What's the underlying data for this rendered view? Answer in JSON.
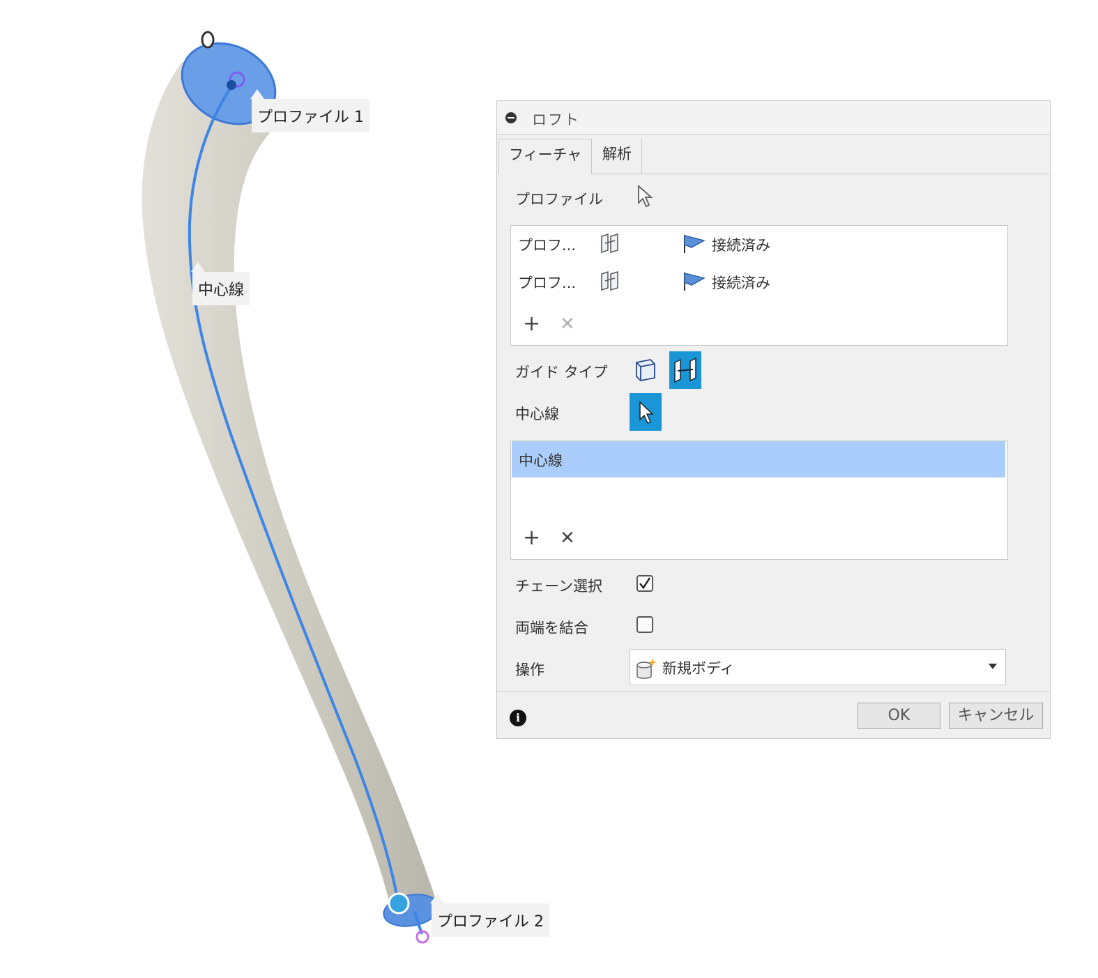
{
  "viewport": {
    "callout_profile1": "プロファイル 1",
    "callout_centerline": "中心線",
    "callout_profile2": "プロファイル 2"
  },
  "dialog": {
    "title": "ロフト",
    "tabs": [
      {
        "label": "フィーチャ",
        "active": true
      },
      {
        "label": "解析",
        "active": false
      }
    ],
    "profile_label": "プロファイル",
    "profiles": [
      {
        "name": "プロフ...",
        "status": "接続済み"
      },
      {
        "name": "プロフ...",
        "status": "接続済み"
      }
    ],
    "guide_type_label": "ガイド タイプ",
    "centerline_label": "中心線",
    "centerline_items": [
      "中心線"
    ],
    "chain_select_label": "チェーン選択",
    "chain_select_checked": true,
    "closed_label": "両端を結合",
    "closed_checked": false,
    "operation_label": "操作",
    "operation_value": "新規ボディ",
    "ok_label": "OK",
    "cancel_label": "キャンセル"
  },
  "colors": {
    "accent": "#1a96d6",
    "selection": "#aacdfb",
    "profile_face": "#5a96e3",
    "tube": "#cfcdc2"
  }
}
